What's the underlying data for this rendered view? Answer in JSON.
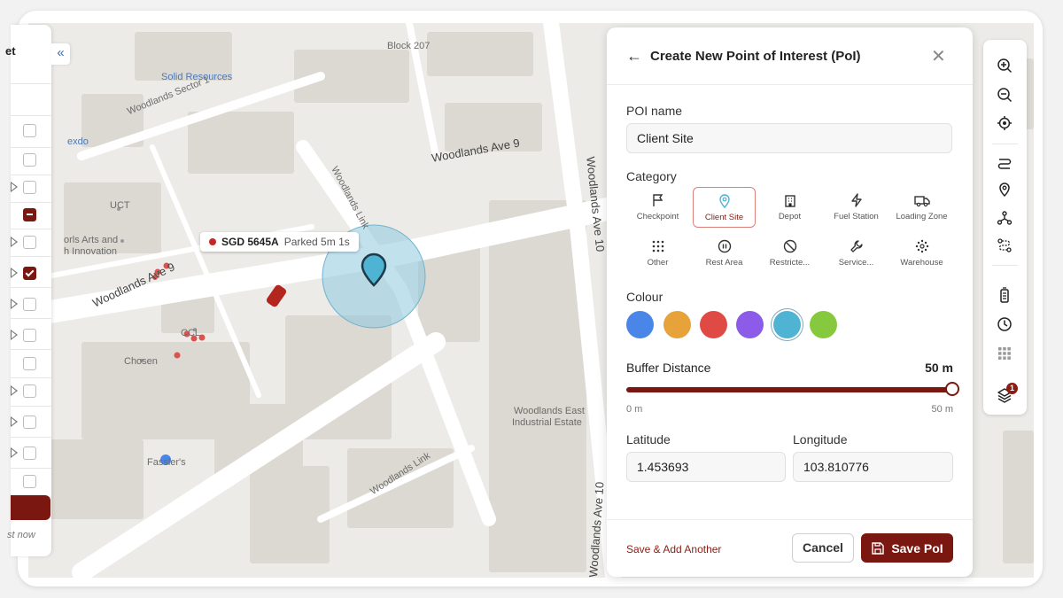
{
  "sidebar": {
    "title_fragment": "et",
    "footer_fragment": "st now",
    "collapse_glyph": "«"
  },
  "map": {
    "labels": [
      {
        "key": "block207",
        "text": "Block 207"
      },
      {
        "key": "solid",
        "text": "Solid Resources"
      },
      {
        "key": "woodlands_sector1",
        "text": "Woodlands Sector 1"
      },
      {
        "key": "exdo",
        "text": "exdo"
      },
      {
        "key": "woodlands_ave9_top",
        "text": "Woodlands Ave 9"
      },
      {
        "key": "woodlands_link_top",
        "text": "Woodlands Link"
      },
      {
        "key": "uct",
        "text": "UCT"
      },
      {
        "key": "arts1",
        "text": "orls Arts and"
      },
      {
        "key": "arts2",
        "text": "h Innovation"
      },
      {
        "key": "woodlands_ave9_left",
        "text": "Woodlands Ave 9"
      },
      {
        "key": "woodlands_ave10_top",
        "text": "Woodlands Ave 10"
      },
      {
        "key": "ccl",
        "text": "CCL"
      },
      {
        "key": "chosen",
        "text": "Chosen"
      },
      {
        "key": "fassler",
        "text": "Fassler's"
      },
      {
        "key": "woodlands_link_bottom",
        "text": "Woodlands Link"
      },
      {
        "key": "woodlands_east1",
        "text": "Woodlands East"
      },
      {
        "key": "woodlands_east2",
        "text": "Industrial Estate"
      },
      {
        "key": "woodlands_ave10_bottom",
        "text": "Woodlands Ave 10"
      }
    ]
  },
  "vehicle_tooltip": {
    "plate": "SGD 5645A",
    "status": "Parked 5m 1s",
    "status_color": "#c62828"
  },
  "dialog": {
    "title": "Create New Point of Interest (PoI)",
    "poi_name_label": "POI name",
    "poi_name_value": "Client Site",
    "category_label": "Category",
    "categories": [
      {
        "label": "Checkpoint",
        "icon": "flag-icon",
        "selected": false
      },
      {
        "label": "Client Site",
        "icon": "map-pin-icon",
        "selected": true
      },
      {
        "label": "Depot",
        "icon": "building-icon",
        "selected": false
      },
      {
        "label": "Fuel Station",
        "icon": "lightning-icon",
        "selected": false
      },
      {
        "label": "Loading Zone",
        "icon": "truck-icon",
        "selected": false
      },
      {
        "label": "Other",
        "icon": "grid-dots-icon",
        "selected": false
      },
      {
        "label": "Rest Area",
        "icon": "pause-circle-icon",
        "selected": false
      },
      {
        "label": "Restricte...",
        "icon": "ban-icon",
        "selected": false
      },
      {
        "label": "Service...",
        "icon": "wrench-icon",
        "selected": false
      },
      {
        "label": "Warehouse",
        "icon": "warehouse-dots-icon",
        "selected": false
      }
    ],
    "colour_label": "Colour",
    "colours": [
      "#4a86e8",
      "#e8a23a",
      "#e04a45",
      "#8c5ce8",
      "#4fb3d4",
      "#86c93f"
    ],
    "selected_colour": "#4fb3d4",
    "buffer_label": "Buffer Distance",
    "buffer_value": "50 m",
    "buffer_fraction": 1.0,
    "buffer_min": "0 m",
    "buffer_max": "50 m",
    "latitude_label": "Latitude",
    "latitude_value": "1.453693",
    "longitude_label": "Longitude",
    "longitude_value": "103.810776",
    "save_add_label": "Save & Add Another",
    "cancel_label": "Cancel",
    "save_label": "Save PoI",
    "accent": "#7a1710"
  },
  "toolbar": {
    "layers_badge": "1",
    "icons": [
      "zoom-in-icon",
      "zoom-out-icon",
      "locate-icon",
      "route-icon",
      "pin-icon",
      "waypoint-icon",
      "path-icon",
      "battery-icon",
      "clock-icon",
      "grid-icon",
      "layers-icon"
    ]
  }
}
